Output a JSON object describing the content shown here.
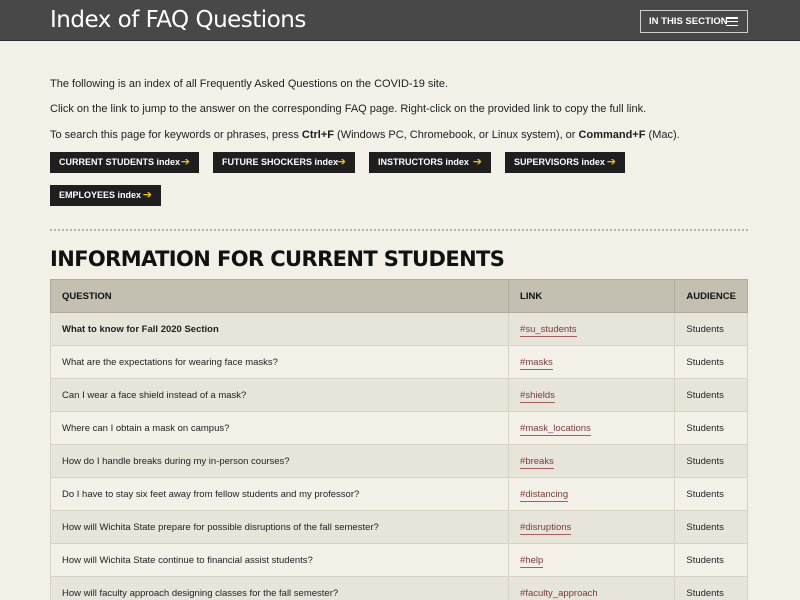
{
  "header": {
    "title": "Index of FAQ Questions",
    "section_button": "IN THIS SECTION"
  },
  "intro": {
    "line1": "The following is an index of all Frequently Asked Questions on the COVID-19 site.",
    "line2": "Click on the link to jump to the answer on the corresponding FAQ page. Right-click on the provided link to copy the full link.",
    "line3_a": "To search this page for keywords or phrases, press ",
    "line3_k1": "Ctrl+F",
    "line3_b": " (Windows PC, Chromebook, or Linux system), or ",
    "line3_k2": "Command+F",
    "line3_c": " (Mac)."
  },
  "index_buttons": [
    "CURRENT STUDENTS index",
    "FUTURE SHOCKERS index",
    "INSTRUCTORS index",
    "SUPERVISORS index",
    "EMPLOYEES index"
  ],
  "arrow_glyph": "➔",
  "section_title": "INFORMATION FOR CURRENT STUDENTS",
  "table": {
    "headers": [
      "QUESTION",
      "LINK",
      "AUDIENCE"
    ],
    "rows": [
      {
        "q": "What to know for Fall 2020 Section",
        "link": "#su_students",
        "aud": "Students"
      },
      {
        "q": "What are the expectations for wearing face masks?",
        "link": "#masks",
        "aud": "Students"
      },
      {
        "q": "Can I wear a face shield instead of a mask?",
        "link": "#shields",
        "aud": "Students"
      },
      {
        "q": "Where can I obtain a mask on campus?",
        "link": "#mask_locations",
        "aud": "Students"
      },
      {
        "q": "How do I handle breaks during my in-person courses?",
        "link": "#breaks",
        "aud": "Students"
      },
      {
        "q": "Do I have to stay six feet away from fellow students and my professor?",
        "link": "#distancing",
        "aud": "Students"
      },
      {
        "q": "How will Wichita State prepare for possible disruptions of the fall semester?",
        "link": "#disruptions",
        "aud": "Students"
      },
      {
        "q": "How will Wichita State continue to financial assist students?",
        "link": "#help",
        "aud": "Students"
      },
      {
        "q": "How will faculty approach designing classes for the fall semester?",
        "link": "#faculty_approach",
        "aud": "Students"
      }
    ]
  },
  "colors": {
    "header_bg": "#484848",
    "page_bg": "#f3f0e8",
    "button_bg": "#1f1f1f",
    "arrow": "#f5c400",
    "link": "#7a3a3a"
  }
}
